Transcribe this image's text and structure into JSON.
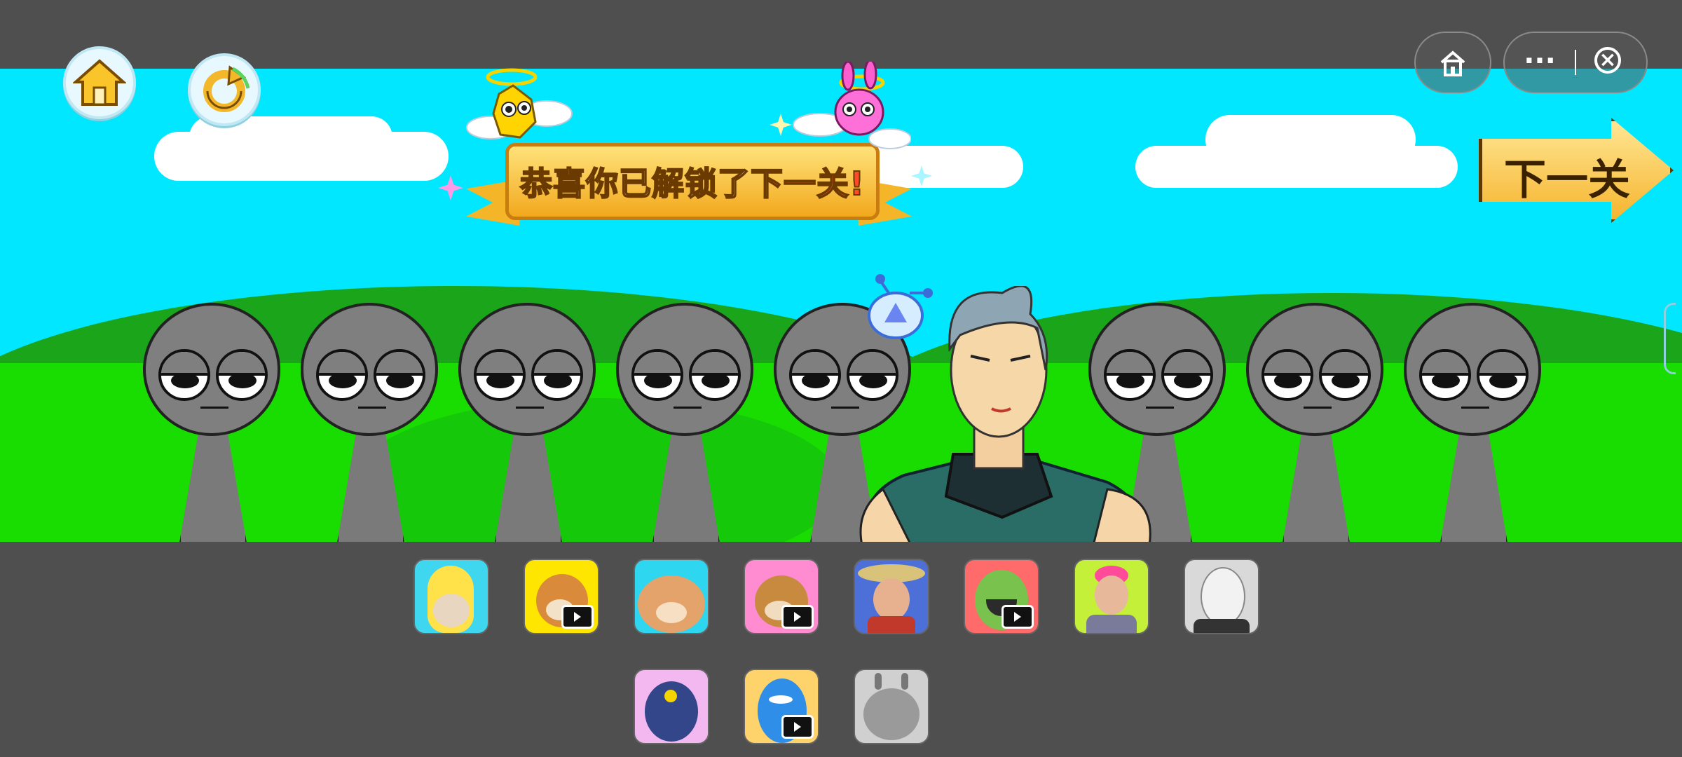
{
  "banner": {
    "text_main": "恭喜你已解锁了",
    "text_highlight": "下一关!"
  },
  "next_level": {
    "label": "下一关"
  },
  "capsule": {
    "more_glyph": "···",
    "close_glyph": "×"
  },
  "colors": {
    "sky": "#00e7ff",
    "grass": "#19dc00",
    "dark_hill": "#1aa51a",
    "sprunki_gray": "#7f7f7f",
    "banner_gold": "#f6b52f",
    "highlight_red": "#ff4a2a"
  },
  "icons": [
    "home-icon",
    "restart-icon",
    "mini-home-icon",
    "more-icon",
    "close-icon",
    "video-icon"
  ],
  "thumbnails": [
    {
      "name": "banana-cat",
      "bg": "#3fd6f0",
      "video": false
    },
    {
      "name": "doge",
      "bg": "#ffe600",
      "video": true
    },
    {
      "name": "orange-cat",
      "bg": "#2fd6f0",
      "video": false
    },
    {
      "name": "cheems",
      "bg": "#ff8bd1",
      "video": true
    },
    {
      "name": "farmer",
      "bg": "#4c6fd8",
      "video": false
    },
    {
      "name": "cactus",
      "bg": "#ff6a6a",
      "video": true
    },
    {
      "name": "headset-guy",
      "bg": "#c4f03a",
      "video": false
    },
    {
      "name": "gray-face",
      "bg": "#d9d9d9",
      "video": false
    },
    {
      "name": "pigeon",
      "bg": "#f4b8f0",
      "video": false
    },
    {
      "name": "blue-bird",
      "bg": "#ffd36b",
      "video": true
    },
    {
      "name": "gray-cat",
      "bg": "#d0d0d0",
      "video": false
    }
  ]
}
